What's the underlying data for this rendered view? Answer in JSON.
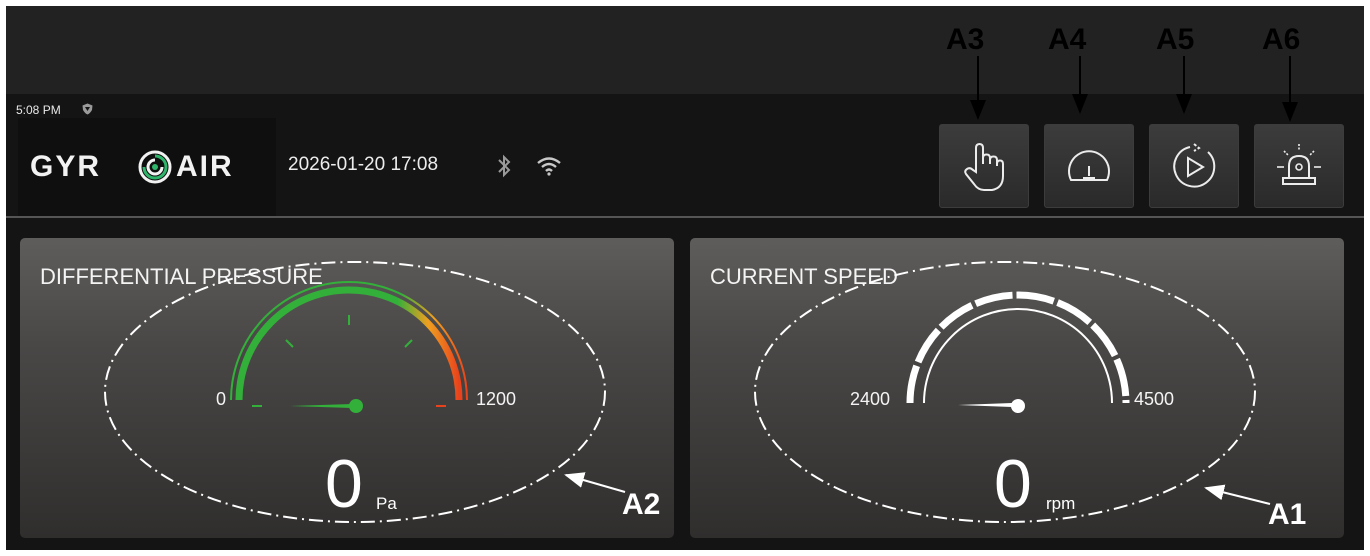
{
  "status_bar": {
    "time": "5:08 PM"
  },
  "header": {
    "logo": {
      "part1": "GYR",
      "part2": "AIR",
      "icon": "swirl-logo-icon"
    },
    "datetime": "2026-01-20 17:08",
    "icons": [
      "bluetooth-icon",
      "wifi-icon"
    ]
  },
  "toolbar": {
    "buttons": [
      {
        "id": "A3",
        "icon": "hand-pointer-icon"
      },
      {
        "id": "A4",
        "icon": "speed-gauge-icon"
      },
      {
        "id": "A5",
        "icon": "play-circle-icon"
      },
      {
        "id": "A6",
        "icon": "alarm-beacon-icon"
      }
    ]
  },
  "panels": {
    "pressure": {
      "title": "DIFFERENTIAL PRESSURE",
      "min": "0",
      "max": "1200",
      "value": "0",
      "unit": "Pa",
      "gauge_level": 0
    },
    "speed": {
      "title": "CURRENT SPEED",
      "min": "2400",
      "max": "4500",
      "value": "0",
      "unit": "rpm",
      "gauge_level": 0
    }
  },
  "callouts": {
    "a1": "A1",
    "a2": "A2",
    "a3": "A3",
    "a4": "A4",
    "a5": "A5",
    "a6": "A6"
  },
  "colors": {
    "screen_bg": "#141414",
    "card_top": "#5f5d5b",
    "gauge_green": "#33b03a",
    "gauge_orange": "#f0a020",
    "gauge_red": "#e8431c",
    "annotation": "#000000"
  }
}
